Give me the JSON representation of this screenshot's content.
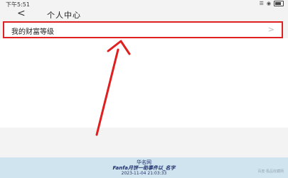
{
  "status_bar": {
    "time": "下午5:51",
    "signal": "☰",
    "wifi": "◉"
  },
  "nav": {
    "back_symbol": "<",
    "title": "个人中心"
  },
  "menu": {
    "wealth_label": "我的财富等级",
    "arrow_symbol": ">"
  },
  "annotation": {
    "color": "#e02020"
  },
  "footer": {
    "line1": "华名网",
    "line2": "Fanfa月饼一助事件以_名字",
    "line3": "2023-11-04 21:03:33",
    "watermark": "百度·极品收藏网"
  }
}
